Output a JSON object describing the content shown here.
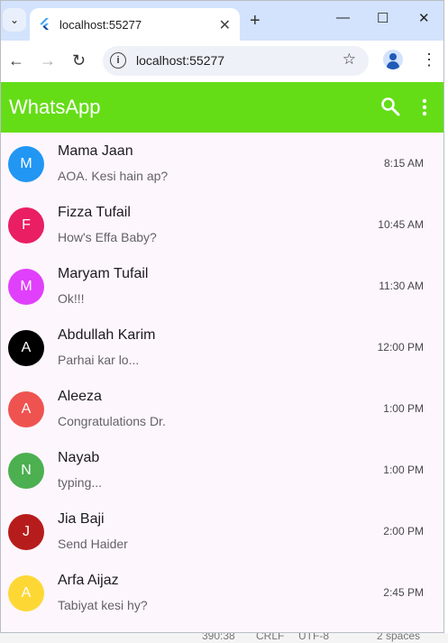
{
  "browser": {
    "tab_title": "localhost:55277",
    "url": "localhost:55277",
    "tab_close": "✕",
    "new_tab": "+",
    "tab_menu": "⌄",
    "win_min": "—",
    "win_max": "☐",
    "win_close": "✕",
    "back": "←",
    "forward": "→",
    "reload": "↻",
    "info_glyph": "i",
    "star": "☆",
    "menu": "⋮"
  },
  "app": {
    "title": "WhatsApp",
    "accent": "#64dd17",
    "search_icon": "search-icon",
    "more_icon": "more-vert-icon"
  },
  "chats": [
    {
      "initial": "M",
      "name": "Mama Jaan",
      "message": "AOA. Kesi hain ap?",
      "time": "8:15 AM",
      "color": "#2196f3"
    },
    {
      "initial": "F",
      "name": "Fizza Tufail",
      "message": "How's Effa Baby?",
      "time": "10:45 AM",
      "color": "#e91e63"
    },
    {
      "initial": "M",
      "name": "Maryam Tufail",
      "message": "Ok!!!",
      "time": "11:30 AM",
      "color": "#e040fb"
    },
    {
      "initial": "A",
      "name": "Abdullah Karim",
      "message": "Parhai kar lo...",
      "time": "12:00 PM",
      "color": "#000000"
    },
    {
      "initial": "A",
      "name": "Aleeza",
      "message": "Congratulations Dr.",
      "time": "1:00 PM",
      "color": "#ef5350"
    },
    {
      "initial": "N",
      "name": "Nayab",
      "message": "typing...",
      "time": "1:00 PM",
      "color": "#4caf50"
    },
    {
      "initial": "J",
      "name": "Jia Baji",
      "message": "Send Haider",
      "time": "2:00 PM",
      "color": "#b71c1c"
    },
    {
      "initial": "A",
      "name": "Arfa Aijaz",
      "message": "Tabiyat kesi hy?",
      "time": "2:45 PM",
      "color": "#fdd835"
    }
  ],
  "editor_status": {
    "position": "390:38",
    "eol": "CRLF",
    "encoding": "UTF-8",
    "indent": "2 spaces"
  }
}
